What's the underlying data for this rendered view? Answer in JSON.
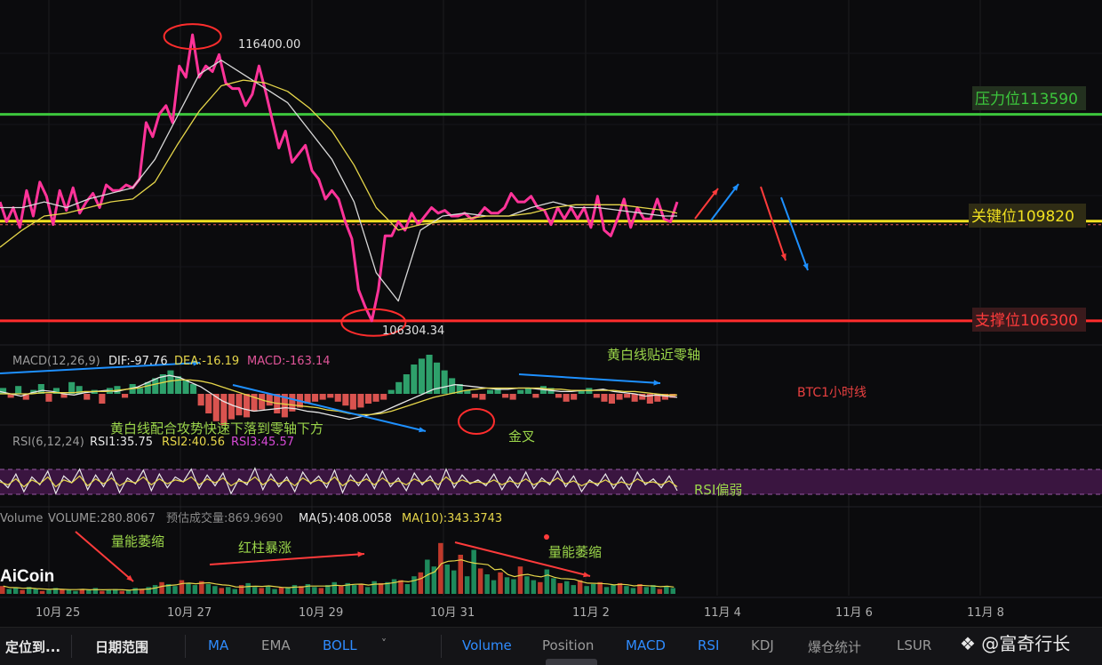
{
  "chart_data": {
    "type": "line",
    "title": "BTC1小时线",
    "x_ticks": [
      "10月 25",
      "10月 27",
      "10月 29",
      "10月 31",
      "11月 2",
      "11月 4",
      "11月 6",
      "11月 8"
    ],
    "y_range": [
      105700,
      117000
    ],
    "series": [
      {
        "name": "price",
        "x": [
          0,
          3,
          6,
          9,
          12,
          15,
          18,
          21,
          24,
          27,
          30,
          33,
          36,
          39,
          42,
          45,
          48,
          51,
          54,
          57,
          60,
          63,
          66,
          69,
          72,
          75,
          78,
          81,
          84,
          87,
          90,
          93,
          96,
          99,
          102,
          105,
          108,
          111,
          114,
          117,
          120,
          123,
          126,
          129,
          132,
          135,
          138,
          141,
          144,
          147,
          150,
          153,
          156,
          159,
          162,
          165,
          168,
          171,
          174,
          177,
          180,
          183,
          186,
          189,
          192,
          195,
          198,
          201,
          204,
          207,
          210,
          213,
          216,
          219,
          222,
          225,
          228,
          231,
          234,
          237,
          240,
          243,
          246,
          249,
          252,
          255,
          258,
          261,
          264,
          267,
          270,
          273,
          276,
          279,
          282,
          285,
          288,
          291,
          294,
          297,
          300,
          303,
          306
        ],
        "values": [
          110500,
          109800,
          110300,
          109600,
          110900,
          110000,
          111200,
          110700,
          109700,
          110900,
          110200,
          111000,
          110100,
          110500,
          110800,
          110300,
          111100,
          110900,
          110900,
          111100,
          111000,
          111300,
          113300,
          112800,
          113600,
          113900,
          113300,
          115300,
          114900,
          116400,
          114900,
          115300,
          115100,
          115700,
          114700,
          114500,
          114500,
          113900,
          114300,
          115300,
          114400,
          113400,
          112400,
          113000,
          111900,
          112200,
          112500,
          111600,
          111300,
          110600,
          110900,
          110600,
          109800,
          109200,
          107400,
          106800,
          106304,
          107400,
          109300,
          109300,
          109800,
          109500,
          110100,
          109700,
          110000,
          110300,
          110100,
          110200,
          110000,
          110000,
          110100,
          109900,
          110000,
          110300,
          110100,
          110100,
          110300,
          110800,
          110500,
          110500,
          110700,
          110300,
          110200,
          109700,
          110300,
          109900,
          110300,
          109900,
          110300,
          109600,
          110700,
          109500,
          109300,
          109900,
          110600,
          109600,
          110300,
          109900,
          109900,
          110600,
          109900,
          109800,
          110500
        ]
      },
      {
        "name": "MA-white",
        "x": [
          0,
          10,
          20,
          30,
          40,
          50,
          60,
          70,
          80,
          90,
          100,
          110,
          120,
          130,
          140,
          150,
          160,
          170,
          180,
          190,
          200,
          210,
          220,
          230,
          240,
          250,
          260,
          270,
          280,
          290,
          300,
          306
        ],
        "values": [
          110300,
          110300,
          110500,
          110300,
          110600,
          110800,
          111000,
          112000,
          113500,
          115000,
          115500,
          115000,
          114500,
          114000,
          113000,
          112000,
          110500,
          108000,
          107000,
          109500,
          110000,
          110100,
          110000,
          110000,
          110300,
          110500,
          110300,
          110300,
          110200,
          110100,
          110000,
          110000
        ]
      },
      {
        "name": "MA-yellow",
        "x": [
          0,
          10,
          20,
          30,
          40,
          50,
          60,
          70,
          80,
          90,
          100,
          110,
          120,
          130,
          140,
          150,
          160,
          170,
          180,
          190,
          200,
          210,
          220,
          230,
          240,
          250,
          260,
          270,
          280,
          290,
          300,
          306
        ],
        "values": [
          108900,
          109500,
          110000,
          110100,
          110300,
          110500,
          110600,
          111200,
          112500,
          113700,
          114600,
          114800,
          114700,
          114400,
          113800,
          113000,
          111800,
          110300,
          109500,
          109700,
          109800,
          109900,
          110000,
          110000,
          110100,
          110300,
          110400,
          110400,
          110400,
          110300,
          110200,
          110100
        ]
      }
    ],
    "labels": {
      "high": "116400.00",
      "low": "106304.34",
      "resistance": "压力位113590",
      "key": "关键位109820",
      "support": "支撑位106300"
    },
    "levels": {
      "resistance": 113590,
      "key": 109820,
      "support": 106300
    },
    "colors": {
      "candle": "#ff3399",
      "ma_white": "#d8d8d8",
      "ma_yellow": "#e6d64a",
      "resistance": "#3cc63c",
      "key": "#f0e020",
      "support": "#ff2d2d",
      "arrow_blue": "#1e90ff",
      "arrow_red": "#ff3b3b",
      "text_green": "#9bd64a"
    }
  },
  "macd": {
    "name": "MACD(12,26,9)",
    "dif": "DIF:-97.76",
    "dea": "DEA:-16.19",
    "macd": "MACD:-163.14",
    "hist": [
      3,
      -2,
      4,
      -3,
      2,
      5,
      -4,
      3,
      -2,
      6,
      4,
      -3,
      2,
      -5,
      3,
      4,
      -2,
      5,
      3,
      6,
      8,
      10,
      12,
      9,
      7,
      5,
      -6,
      -10,
      -14,
      -16,
      -13,
      -11,
      -12,
      -9,
      -8,
      -6,
      -10,
      -12,
      -9,
      -7,
      -5,
      -4,
      -3,
      -2,
      -4,
      -6,
      -8,
      -7,
      -5,
      -4,
      -3,
      2,
      6,
      10,
      15,
      18,
      20,
      16,
      12,
      8,
      5,
      2,
      -2,
      -3,
      2,
      3,
      -2,
      -3,
      2,
      3,
      -2,
      4,
      3,
      -2,
      -4,
      -3,
      2,
      3,
      -2,
      -4,
      -5,
      -3,
      -2,
      -4,
      -3,
      -5,
      -4,
      -3,
      -2
    ],
    "dif_series": [
      2,
      0,
      -2,
      1,
      3,
      2,
      0,
      -1,
      1,
      2,
      3,
      2,
      4,
      6,
      10,
      14,
      16,
      14,
      10,
      6,
      0,
      -6,
      -10,
      -13,
      -15,
      -14,
      -13,
      -12,
      -13,
      -15,
      -16,
      -18,
      -20,
      -22,
      -20,
      -18,
      -16,
      -12,
      -8,
      -4,
      0,
      4,
      6,
      8,
      7,
      6,
      5,
      4,
      4,
      5,
      5,
      4,
      3,
      2,
      2,
      3,
      3,
      4,
      2,
      1,
      0,
      -2,
      -1,
      -2,
      -3
    ],
    "dea_series": [
      0,
      0,
      0,
      0,
      1,
      1,
      1,
      1,
      2,
      2,
      2,
      3,
      4,
      5,
      7,
      9,
      11,
      12,
      12,
      11,
      9,
      6,
      3,
      0,
      -3,
      -6,
      -8,
      -9,
      -10,
      -11,
      -12,
      -14,
      -15,
      -17,
      -18,
      -18,
      -17,
      -15,
      -12,
      -9,
      -6,
      -3,
      -1,
      1,
      3,
      4,
      5,
      5,
      5,
      5,
      5,
      5,
      4,
      4,
      3,
      3,
      3,
      3,
      3,
      2,
      2,
      1,
      0,
      -1,
      -1
    ]
  },
  "rsi": {
    "name": "RSI(6,12,24)",
    "rsi1": "RSI1:35.75",
    "rsi2": "RSI2:40.56",
    "rsi3": "RSI3:45.57",
    "values1": [
      52,
      44,
      58,
      40,
      55,
      47,
      61,
      38,
      56,
      49,
      63,
      42,
      57,
      45,
      60,
      39,
      54,
      48,
      62,
      41,
      58,
      44,
      55,
      50,
      63,
      43,
      57,
      46,
      59,
      38,
      53,
      47,
      64,
      42,
      58,
      45,
      55,
      40,
      60,
      48,
      56,
      44,
      62,
      39,
      57,
      46,
      58,
      43,
      61,
      45,
      54,
      41,
      59,
      47,
      56,
      42,
      63,
      44,
      57,
      48,
      52,
      46,
      58,
      42,
      55,
      44,
      60,
      43,
      54,
      47,
      61,
      45,
      56,
      40,
      52,
      46,
      58,
      43,
      55,
      42,
      60,
      47,
      53,
      44,
      56,
      41
    ],
    "values2": [
      50,
      47,
      53,
      45,
      52,
      48,
      55,
      45,
      52,
      49,
      56,
      46,
      53,
      48,
      54,
      46,
      51,
      49,
      55,
      47,
      53,
      48,
      52,
      50,
      55,
      47,
      53,
      49,
      54,
      46,
      51,
      49,
      55,
      47,
      53,
      48,
      52,
      46,
      54,
      49,
      52,
      48,
      55,
      46,
      52,
      49,
      53,
      47,
      54,
      48,
      51,
      47,
      53,
      49,
      52,
      47,
      55,
      48,
      52,
      49,
      50,
      48,
      52,
      47,
      51,
      48,
      53,
      47,
      51,
      49,
      54,
      48,
      51,
      46,
      50,
      48,
      52,
      47,
      50,
      47,
      53,
      49,
      50,
      47,
      51,
      45
    ]
  },
  "volume": {
    "name": "Volume",
    "volume": "VOLUME:280.8067",
    "estimate": "预估成交量:869.9690",
    "ma5": "MA(5):408.0058",
    "ma10": "MA(10):343.3743",
    "bars": [
      8,
      5,
      6,
      4,
      7,
      5,
      3,
      4,
      6,
      5,
      4,
      3,
      5,
      4,
      6,
      3,
      4,
      5,
      3,
      4,
      6,
      5,
      7,
      9,
      12,
      10,
      8,
      14,
      11,
      9,
      13,
      10,
      8,
      6,
      7,
      5,
      9,
      11,
      7,
      6,
      8,
      5,
      7,
      6,
      9,
      8,
      10,
      7,
      6,
      9,
      12,
      8,
      11,
      9,
      10,
      7,
      13,
      11,
      12,
      15,
      14,
      10,
      18,
      22,
      35,
      28,
      52,
      30,
      24,
      40,
      18,
      45,
      26,
      20,
      14,
      22,
      17,
      15,
      28,
      18,
      14,
      12,
      25,
      16,
      11,
      13,
      9,
      14,
      8,
      10,
      12,
      7,
      9,
      11,
      8,
      6,
      10,
      7,
      9,
      5,
      8,
      6
    ]
  },
  "annotations": {
    "macd_near_zero": "黄白线贴近零轴",
    "macd_drop": "黄白线配合攻势快速下落到零轴下方",
    "golden_cross": "金叉",
    "rsi_weak": "RSI偏弱",
    "vol_shrink1": "量能萎缩",
    "vol_red_surge": "红柱暴涨",
    "vol_shrink2": "量能萎缩"
  },
  "logo": "AiCoin",
  "toolbar": {
    "locate": "定位到...",
    "date_range": "日期范围",
    "ma": "MA",
    "ema": "EMA",
    "boll": "BOLL",
    "more": "˅",
    "volume": "Volume",
    "position": "Position",
    "macd": "MACD",
    "rsi": "RSI",
    "kdj": "KDJ",
    "liquidation": "爆仓统计",
    "lsur": "LSUR"
  },
  "watermark": "富奇行长"
}
